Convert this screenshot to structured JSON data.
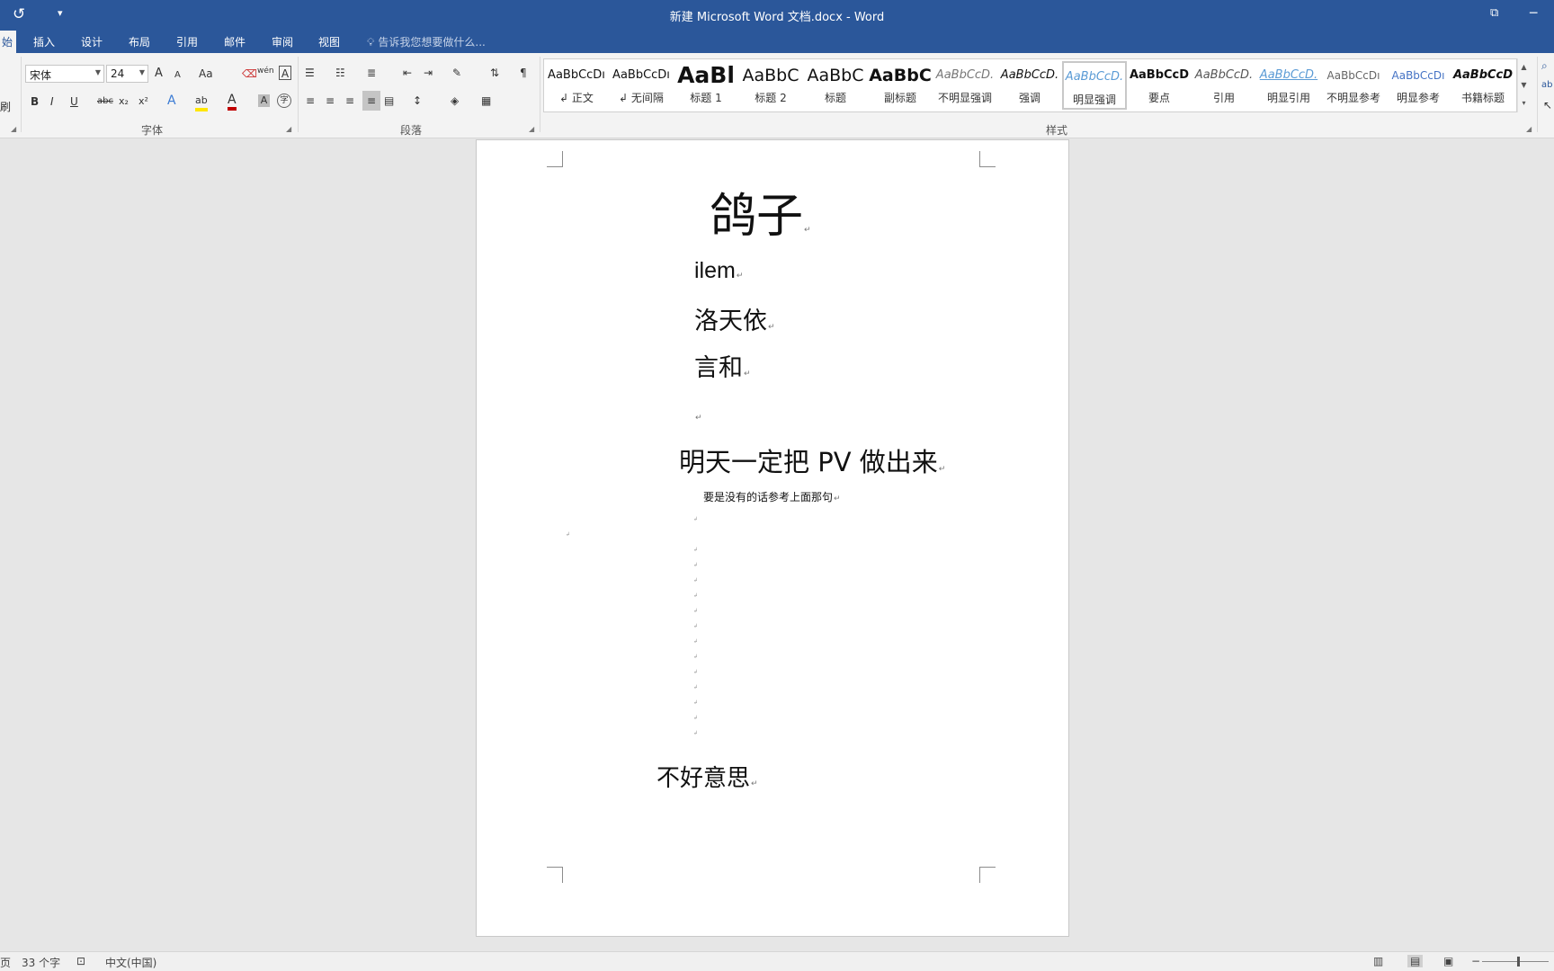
{
  "titlebar": {
    "title": "新建 Microsoft Word 文档.docx - Word",
    "undo_icon": "↺",
    "qa_dropdown_icon": "▾",
    "restore_icon": "⧉",
    "minimize_icon": "─"
  },
  "tabs": {
    "home_partial": "始",
    "insert": "插入",
    "design": "设计",
    "layout": "布局",
    "references": "引用",
    "mailings": "邮件",
    "review": "审阅",
    "view": "视图",
    "tell_me": "告诉我您想要做什么..."
  },
  "ribbon": {
    "clipboard_partial": "刷",
    "font": {
      "name": "宋体",
      "size": "24",
      "group_label": "字体",
      "grow": "A",
      "shrink": "A",
      "change_case": "Aa",
      "phonetic": "wén",
      "char_border": "A",
      "bold": "B",
      "italic": "I",
      "underline": "U",
      "strike": "abc",
      "subscript": "x₂",
      "superscript": "x²",
      "text_effects": "A",
      "highlight": "ab",
      "font_color": "A",
      "char_shading": "A",
      "enclose": "字"
    },
    "paragraph": {
      "group_label": "段落"
    },
    "styles": {
      "group_label": "样式",
      "items": [
        {
          "preview": "AaBbCcDı",
          "name": "正文"
        },
        {
          "preview": "AaBbCcDı",
          "name": "无间隔"
        },
        {
          "preview": "AaBl",
          "name": "标题 1"
        },
        {
          "preview": "AaBbC",
          "name": "标题 2"
        },
        {
          "preview": "AaBbC",
          "name": "标题"
        },
        {
          "preview": "AaBbC",
          "name": "副标题"
        },
        {
          "preview": "AaBbCcD.",
          "name": "不明显强调"
        },
        {
          "preview": "AaBbCcD.",
          "name": "强调"
        },
        {
          "preview": "AaBbCcD.",
          "name": "明显强调"
        },
        {
          "preview": "AaBbCcD",
          "name": "要点"
        },
        {
          "preview": "AaBbCcD.",
          "name": "引用"
        },
        {
          "preview": "AaBbCcD.",
          "name": "明显引用"
        },
        {
          "preview": "AaBbCcDı",
          "name": "不明显参考"
        },
        {
          "preview": "AaBbCcDı",
          "name": "明显参考"
        },
        {
          "preview": "AaBbCcD",
          "name": "书籍标题"
        }
      ]
    }
  },
  "document": {
    "title": "鸽子",
    "line_1": "ilem",
    "line_2": "洛天依",
    "line_3": "言和",
    "heading_line": "明天一定把 PV 做出来",
    "small_line": "要是没有的话参考上面那句",
    "closing_line": "不好意思",
    "paragraph_mark": "↵"
  },
  "statusbar": {
    "page_partial": "页",
    "word_count": "33 个字",
    "language": "中文(中国)",
    "zoom_out": "−"
  },
  "colors": {
    "accent": "#2b579a",
    "ribbon_bg": "#f3f3f3",
    "canvas_bg": "#e6e6e6"
  }
}
